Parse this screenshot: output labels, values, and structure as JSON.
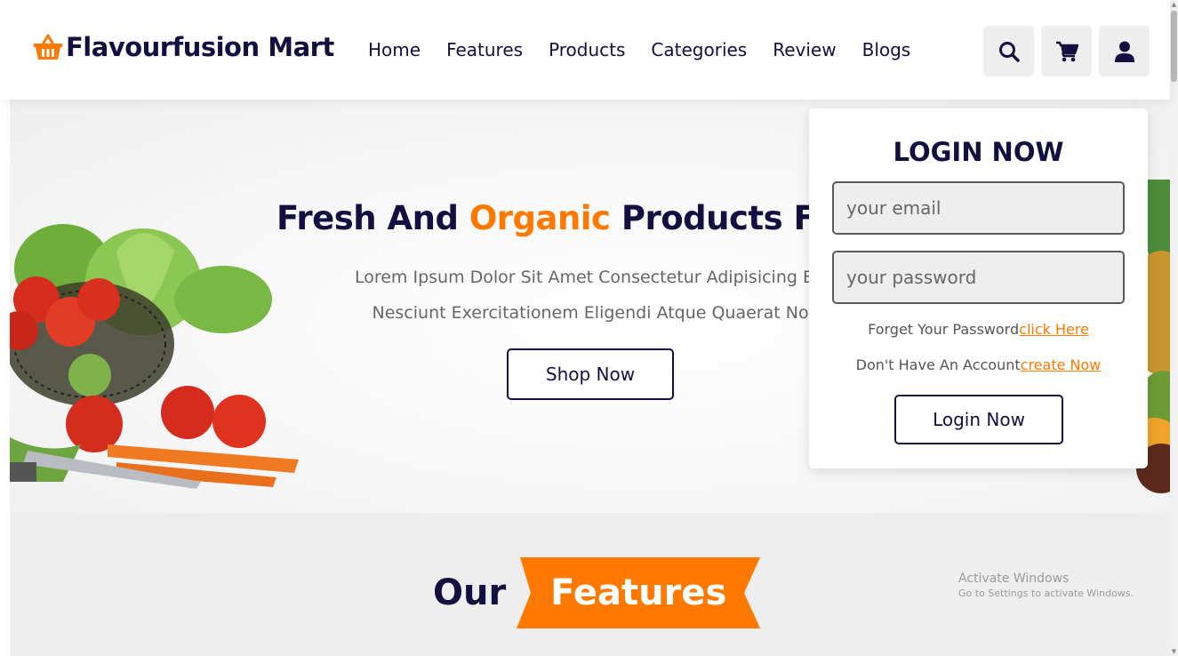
{
  "header": {
    "logo_text": "Flavourfusion Mart",
    "logo_icon": "basket-icon",
    "nav": [
      "Home",
      "Features",
      "Products",
      "Categories",
      "Review",
      "Blogs"
    ],
    "icons": [
      "search-icon",
      "cart-icon",
      "user-icon"
    ]
  },
  "hero": {
    "title_part1": "Fresh And ",
    "title_accent": "Organic",
    "title_part2": " Products For",
    "text_line1": "Lorem Ipsum Dolor Sit Amet Consectetur Adipisicing Elit.",
    "text_line2": "Nesciunt Exercitationem Eligendi Atque Quaerat Nos",
    "button": "Shop Now"
  },
  "login": {
    "title": "LOGIN NOW",
    "email_placeholder": "your email",
    "password_placeholder": "your password",
    "forgot_text": "Forget Your Password",
    "forgot_link": "click Here",
    "account_text": "Don't Have An Account",
    "account_link": "create Now",
    "button": "Login Now"
  },
  "features": {
    "heading_part1": "Our",
    "heading_part2": "Features"
  },
  "watermark": {
    "line1": "Activate Windows",
    "line2": "Go to Settings to activate Windows."
  },
  "colors": {
    "primary": "#130f40",
    "accent": "#ff7800",
    "panel": "#eeeeee"
  }
}
